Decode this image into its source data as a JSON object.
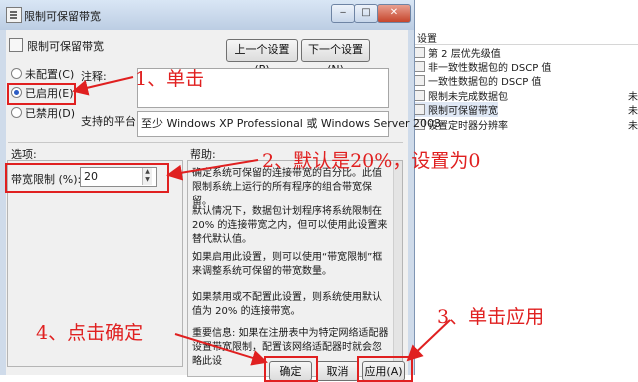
{
  "background": {
    "header": "设置",
    "rows": [
      {
        "label": "第 2 层优先级值",
        "tail": ""
      },
      {
        "label": "非一致性数据包的 DSCP 值",
        "tail": ""
      },
      {
        "label": "一致性数据包的 DSCP 值",
        "tail": ""
      },
      {
        "label": "限制未完成数据包",
        "tail": "未"
      },
      {
        "label": "限制可保留带宽",
        "tail": "未"
      },
      {
        "label": "设置定时器分辨率",
        "tail": "未"
      }
    ]
  },
  "dialog": {
    "title": "限制可保留带宽",
    "setting_name": "限制可保留带宽",
    "prev_button": "上一个设置(P)",
    "next_button": "下一个设置(N)",
    "radio_not_configured": "未配置(C)",
    "radio_enabled": "已启用(E)",
    "radio_disabled": "已禁用(D)",
    "comment_label": "注释:",
    "platform_label": "支持的平台:",
    "platform_value": "至少 Windows XP Professional 或 Windows Server 2003",
    "options_label": "选项:",
    "help_label": "帮助:",
    "bandwidth_label": "带宽限制 (%):",
    "bandwidth_value": "20",
    "help_p1": "确定系统可保留的连接带宽的百分比。此值限制系统上运行的所有程序的组合带宽保留。",
    "help_p2": "默认情况下，数据包计划程序将系统限制在 20% 的连接带宽之内，但可以使用此设置来替代默认值。",
    "help_p3": "如果启用此设置，则可以使用“带宽限制”框来调整系统可保留的带宽数量。",
    "help_p4": "如果禁用或不配置此设置，则系统使用默认值为 20% 的连接带宽。",
    "help_p5": "重要信息: 如果在注册表中为特定网络适配器设置带宽限制，配置该网络适配器时就会忽略此设",
    "ok_button": "确定",
    "cancel_button": "取消",
    "apply_button": "应用(A)"
  },
  "annotations": {
    "step1": "1、单击",
    "step2": "2、默认是20%，设置为0",
    "step3": "3、单击应用",
    "step4": "4、点击确定"
  },
  "colors": {
    "annotation": "#e02020",
    "title_bar": "#bccde3",
    "selected_row": "#dfe8f5"
  }
}
